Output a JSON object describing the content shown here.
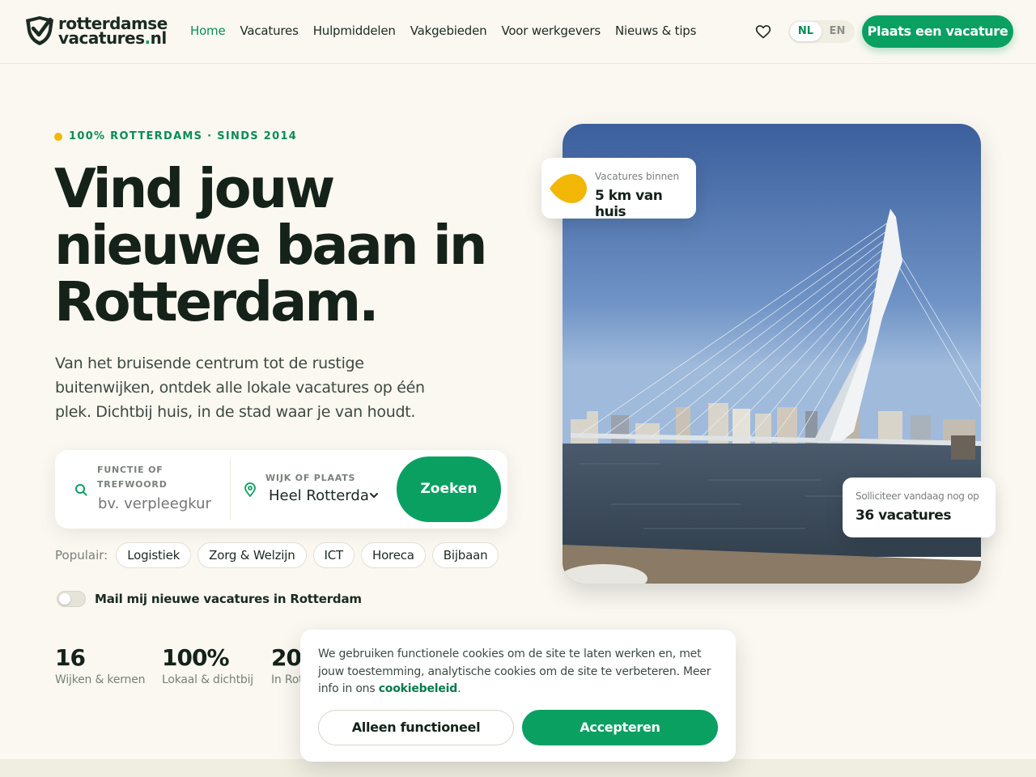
{
  "brand": {
    "line1": "rotterdamse",
    "line2_main": "vacatures",
    "line2_dot": ".",
    "line2_tld": "nl",
    "accent": "#0aa062"
  },
  "nav": {
    "items": [
      {
        "label": "Home",
        "active": true
      },
      {
        "label": "Vacatures"
      },
      {
        "label": "Hulpmiddelen"
      },
      {
        "label": "Vakgebieden"
      },
      {
        "label": "Voor werkgevers"
      },
      {
        "label": "Nieuws & tips"
      }
    ],
    "lang": {
      "nl": "NL",
      "en": "EN",
      "selected": "NL"
    },
    "cta": "Plaats een vacature"
  },
  "hero": {
    "eyebrow": "100% ROTTERDAMS · SINDS 2014",
    "title": "Vind jouw nieuwe baan in Rotterdam.",
    "lead": "Van het bruisende centrum tot de rustige buitenwijken, ontdek alle lokale vacatures op één plek. Dichtbij huis, in de stad waar je van houdt.",
    "search": {
      "keyword_label": "FUNCTIE OF TREFWOORD",
      "keyword_placeholder": "bv. verpleegkundige",
      "place_label": "WIJK OF PLAATS",
      "place_value": "Heel Rotterdam",
      "button": "Zoeken"
    },
    "popular": {
      "label": "Populair:",
      "chips": [
        "Logistiek",
        "Zorg & Welzijn",
        "ICT",
        "Horeca",
        "Bijbaan"
      ]
    },
    "alert_toggle": {
      "label": "Mail mij nieuwe vacatures in Rotterdam",
      "on": false
    },
    "stats": [
      {
        "num": "16",
        "cap": "Wijken & kernen"
      },
      {
        "num": "100%",
        "cap": "Lokaal & dichtbij"
      },
      {
        "num": "20",
        "cap": "In Rot"
      }
    ],
    "card_top": {
      "line1": "Vacatures binnen",
      "line2": "5 km van huis"
    },
    "card_bottom": {
      "line1": "Solliciteer vandaag nog op",
      "line2": "36 vacatures"
    }
  },
  "cookie": {
    "text": "We gebruiken functionele cookies om de site te laten werken en, met jouw toestemming, analytische cookies om de site te verbeteren. Meer info in ons ",
    "link": "cookiebeleid",
    "after": ".",
    "btn_functional": "Alleen functioneel",
    "btn_accept": "Accepteren"
  }
}
